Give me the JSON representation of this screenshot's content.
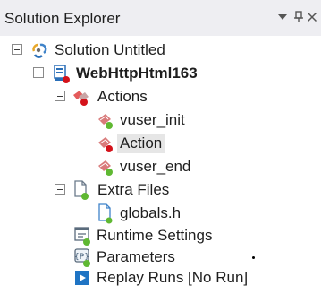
{
  "panel": {
    "title": "Solution Explorer",
    "actions": [
      {
        "name": "dropdown",
        "glyph": "▼"
      },
      {
        "name": "pin",
        "glyph": "ꟷ"
      },
      {
        "name": "close",
        "glyph": "✕"
      }
    ]
  },
  "tree": {
    "solution": {
      "label": "Solution Untitled",
      "expanded": true,
      "icon": "solution-icon"
    },
    "project": {
      "label": "WebHttpHtml163",
      "expanded": true,
      "bold": true,
      "icon": "project-icon",
      "status": "error"
    },
    "actions_folder": {
      "label": "Actions",
      "expanded": true,
      "icon": "actions-folder-icon",
      "status": "error"
    },
    "actions": [
      {
        "label": "vuser_init",
        "icon": "script-icon",
        "status": "ok",
        "selected": false
      },
      {
        "label": "Action",
        "icon": "script-icon",
        "status": "error",
        "selected": true
      },
      {
        "label": "vuser_end",
        "icon": "script-icon",
        "status": "ok",
        "selected": false
      }
    ],
    "extra_files": {
      "label": "Extra Files",
      "expanded": true,
      "icon": "extra-files-icon",
      "status": "ok"
    },
    "extra_file_items": [
      {
        "label": "globals.h",
        "icon": "header-file-icon",
        "status": "ok"
      }
    ],
    "runtime_settings": {
      "label": "Runtime Settings",
      "icon": "runtime-settings-icon",
      "status": "ok"
    },
    "parameters": {
      "label": "Parameters",
      "icon": "parameters-icon",
      "status": "ok"
    },
    "replay_runs": {
      "label": "Replay Runs [No Run]",
      "icon": "replay-runs-icon"
    }
  },
  "colors": {
    "header_bg": "#eeeef2",
    "selection_bg": "#e6e6e6",
    "error_badge": "#d4121a",
    "ok_badge": "#5fb832",
    "text": "#1e1e1e"
  }
}
